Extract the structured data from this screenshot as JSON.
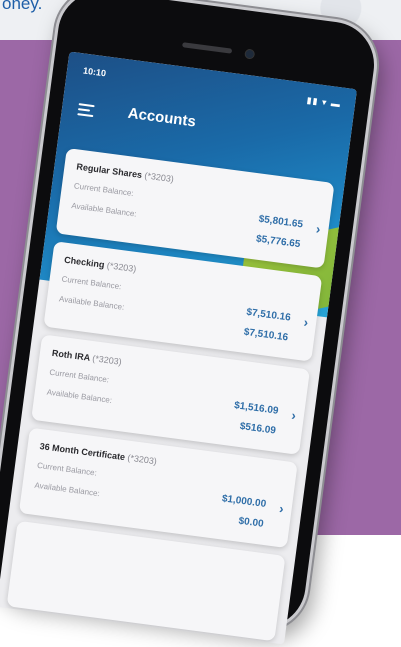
{
  "tagline": "oney.",
  "status_bar": {
    "time": "10:10",
    "icons": "▮▮ ▾ ▬"
  },
  "header": {
    "title": "Accounts"
  },
  "accounts": [
    {
      "name": "Regular Shares",
      "number": "(*3203)",
      "current_label": "Current Balance:",
      "current": "$5,801.65",
      "available_label": "Available Balance:",
      "available": "$5,776.65"
    },
    {
      "name": "Checking",
      "number": "(*3203)",
      "current_label": "Current Balance:",
      "current": "$7,510.16",
      "available_label": "Available Balance:",
      "available": "$7,510.16"
    },
    {
      "name": "Roth IRA",
      "number": "(*3203)",
      "current_label": "Current Balance:",
      "current": "$1,516.09",
      "available_label": "Available Balance:",
      "available": "$516.09"
    },
    {
      "name": "36 Month Certificate",
      "number": "(*3203)",
      "current_label": "Current Balance:",
      "current": "$1,000.00",
      "available_label": "Available Balance:",
      "available": "$0.00"
    }
  ],
  "colors": {
    "background": "#9c68a6",
    "header": "#1a6aa8",
    "amount": "#2f6ea8",
    "accent_green": "#8cbf3c"
  }
}
